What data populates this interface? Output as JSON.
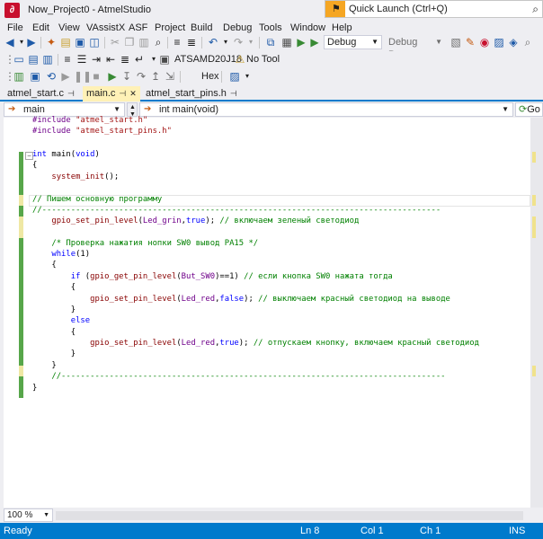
{
  "window": {
    "title": "Now_Project0 - AtmelStudio",
    "quick_launch_placeholder": "Quick Launch (Ctrl+Q)"
  },
  "menu": [
    "File",
    "Edit",
    "View",
    "VAssistX",
    "ASF",
    "Project",
    "Build",
    "Debug",
    "Tools",
    "Window",
    "Help"
  ],
  "toolbar": {
    "configuration": "Debug",
    "debug_browser": "Debug Browser",
    "device": "ATSAMD20J18",
    "tool": "No Tool",
    "hex_label": "Hex"
  },
  "tabs": [
    {
      "label": "atmel_start.c",
      "active": false
    },
    {
      "label": "main.c",
      "active": true
    },
    {
      "label": "atmel_start_pins.h",
      "active": false
    }
  ],
  "navigation": {
    "scope": "main",
    "function": "int main(void)",
    "go_label": "Go"
  },
  "code": {
    "lines": [
      "#include \"atmel_start.h\"",
      "#include \"atmel_start_pins.h\"",
      "",
      "int main(void)",
      "{",
      "    system_init();",
      "",
      "// Пишем основную программу",
      "//------------------------------------------------------------------------------------------------",
      "    gpio_set_pin_level(Led_grin,true); // включаем зеленый светодиод",
      "",
      "    /* Проверка нажатия нопки SW0 вывод PA15 */",
      "    while(1)",
      "    {",
      "        if (gpio_get_pin_level(But_SW0)==1) // если кнопка SW0 нажата тогда",
      "        {",
      "            gpio_set_pin_level(Led_red,false); // выключаем красный светодиод на выводе",
      "        }",
      "        else",
      "        {",
      "            gpio_set_pin_level(Led_red,true); // отпускаем кнопку, включаем красный светодиод",
      "        }",
      "    }",
      "    //---------------------------------------------------------------------------------------------",
      "}"
    ]
  },
  "zoom": "100 %",
  "status": {
    "state": "Ready",
    "line": "Ln 8",
    "col": "Col 1",
    "ch": "Ch 1",
    "mode": "INS"
  },
  "colors": {
    "accent": "#007acc",
    "active_tab": "#fff1b7",
    "quick_launch_flag": "#f5a623",
    "logo": "#c8102e"
  }
}
